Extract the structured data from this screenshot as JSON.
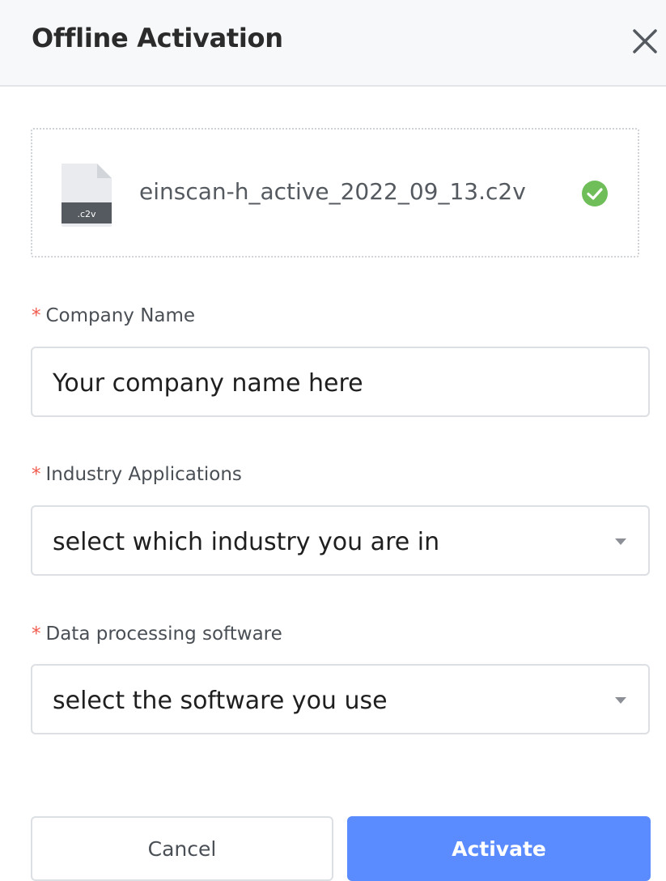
{
  "dialog": {
    "title": "Offline Activation",
    "close_icon": "close-icon"
  },
  "file": {
    "name": "einscan-h_active_2022_09_13.c2v",
    "extension_badge": ".c2v",
    "status_icon": "check-circle-icon",
    "status_color": "#6fbe5a"
  },
  "form": {
    "required_mark": "*",
    "company": {
      "label": "Company Name",
      "value": "Your company name here"
    },
    "industry": {
      "label": "Industry Applications",
      "selected": "select which industry you are in"
    },
    "software": {
      "label": "Data processing software",
      "selected": "select the software you use"
    }
  },
  "buttons": {
    "cancel_label": "Cancel",
    "activate_label": "Activate"
  },
  "colors": {
    "accent": "#5b8cff",
    "required": "#f05a4c"
  }
}
